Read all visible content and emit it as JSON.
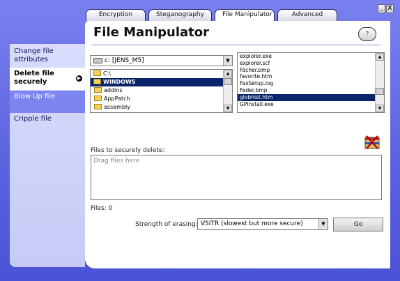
{
  "window": {
    "controls": {
      "minimize": "_",
      "close": "X"
    }
  },
  "tabs": [
    {
      "label": "Encryption",
      "active": false
    },
    {
      "label": "Steganography",
      "active": false
    },
    {
      "label": "File Manipulator",
      "active": true
    },
    {
      "label": "Advanced",
      "active": false
    }
  ],
  "sidebar": {
    "items": [
      {
        "label": "Change file attributes",
        "state": "normal"
      },
      {
        "label": "Delete file securely",
        "state": "selected"
      },
      {
        "label": "Blow Up file",
        "state": "highlighted"
      },
      {
        "label": "Cripple file",
        "state": "normal"
      }
    ]
  },
  "main": {
    "title": "File Manipulator",
    "help_label": "?"
  },
  "drive_selector": {
    "value": "c: [JENS_M5]"
  },
  "folders": [
    {
      "label": "C:\\",
      "selected": false
    },
    {
      "label": "WINDOWS",
      "selected": true
    },
    {
      "label": "addins",
      "selected": false
    },
    {
      "label": "AppPatch",
      "selected": false
    },
    {
      "label": "assembly",
      "selected": false
    }
  ],
  "files": [
    {
      "label": "explorer.exe",
      "selected": false
    },
    {
      "label": "explorer.scf",
      "selected": false
    },
    {
      "label": "Fächer.bmp",
      "selected": false
    },
    {
      "label": "favorite.htm",
      "selected": false
    },
    {
      "label": "FaxSetup.log",
      "selected": false
    },
    {
      "label": "Feder.bmp",
      "selected": false
    },
    {
      "label": "globhist.htm",
      "selected": true
    },
    {
      "label": "GPInstall.exe",
      "selected": false
    }
  ],
  "delete_panel": {
    "files_label": "Files to securely delete:",
    "drop_placeholder": "Drag files here",
    "files_count": "Files: 0"
  },
  "strength": {
    "label": "Strength of erasing:",
    "value": "VSITR (slowest but more secure)",
    "go_label": "Go"
  },
  "colors": {
    "frame": "#5a62df",
    "sidebar": "#d9dcfb",
    "sidebar_highlight": "#7d85ef",
    "selection": "#0a246a"
  },
  "icons": {
    "drive": "hard-drive-icon",
    "folder": "folder-icon",
    "shredder": "shredder-icon",
    "sidebar_bullet": "play-bullet-icon"
  }
}
